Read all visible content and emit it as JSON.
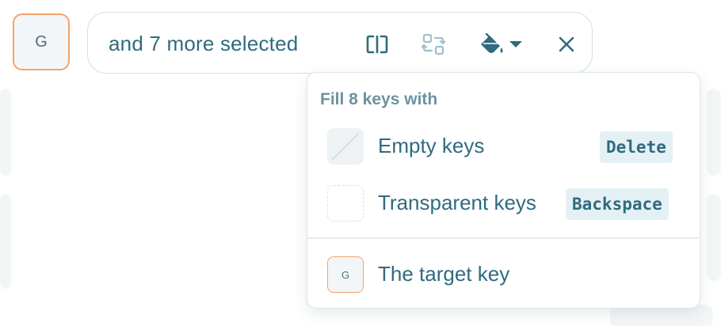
{
  "selection": {
    "key_label": "G",
    "summary": "and 7 more selected"
  },
  "toolbar": {
    "icons": [
      "split-column-icon",
      "swap-icon",
      "fill-bucket-icon",
      "chevron-down-icon",
      "close-icon"
    ]
  },
  "fill_menu": {
    "heading": "Fill 8 keys with",
    "items": [
      {
        "label": "Empty keys",
        "shortcut": "Delete",
        "swatch": "empty"
      },
      {
        "label": "Transparent keys",
        "shortcut": "Backspace",
        "swatch": "transparent"
      },
      {
        "label": "The target key",
        "swatch": "target",
        "swatch_label": "G"
      }
    ]
  },
  "colors": {
    "text": "#2f6b7f",
    "muted": "#6c93a0",
    "accent_orange": "#f5a26a",
    "border": "#d3e0e5",
    "kbd_bg": "#e4f1f4"
  }
}
